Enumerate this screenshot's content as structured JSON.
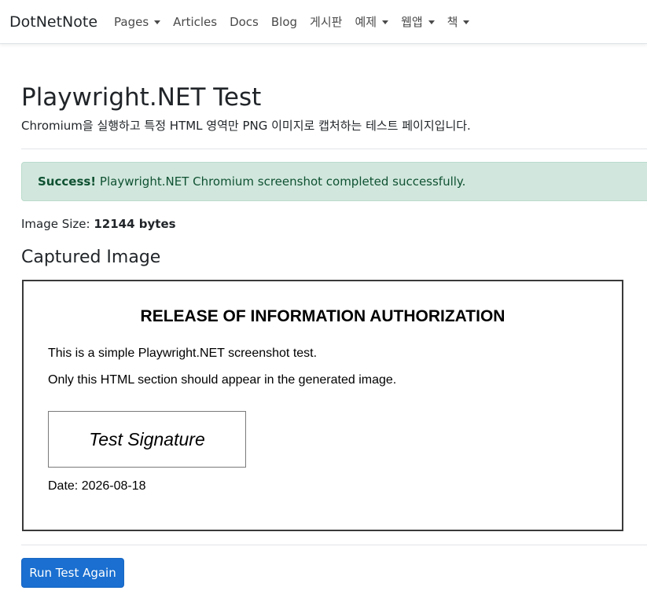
{
  "navbar": {
    "brand": "DotNetNote",
    "items": [
      {
        "label": "Pages",
        "dropdown": true
      },
      {
        "label": "Articles",
        "dropdown": false
      },
      {
        "label": "Docs",
        "dropdown": false
      },
      {
        "label": "Blog",
        "dropdown": false
      },
      {
        "label": "게시판",
        "dropdown": false
      },
      {
        "label": "예제",
        "dropdown": true
      },
      {
        "label": "웹앱",
        "dropdown": true
      },
      {
        "label": "책",
        "dropdown": true
      }
    ]
  },
  "page": {
    "title": "Playwright.NET Test",
    "subtitle": "Chromium을 실행하고 특정 HTML 영역만 PNG 이미지로 캡처하는 테스트 페이지입니다."
  },
  "alert": {
    "strong": "Success!",
    "message": " Playwright.NET Chromium screenshot completed successfully."
  },
  "image_size": {
    "label": "Image Size: ",
    "value": "12144 bytes"
  },
  "captured": {
    "heading": "Captured Image",
    "doc_title": "RELEASE OF INFORMATION AUTHORIZATION",
    "line1": "This is a simple Playwright.NET screenshot test.",
    "line2": "Only this HTML section should appear in the generated image.",
    "signature": "Test Signature",
    "date": "Date: 2026-08-18"
  },
  "actions": {
    "run_again": "Run Test Again"
  },
  "colors": {
    "alert_bg": "#d1e7dd",
    "alert_text": "#0f5132",
    "primary_button": "#1a6fd0"
  }
}
